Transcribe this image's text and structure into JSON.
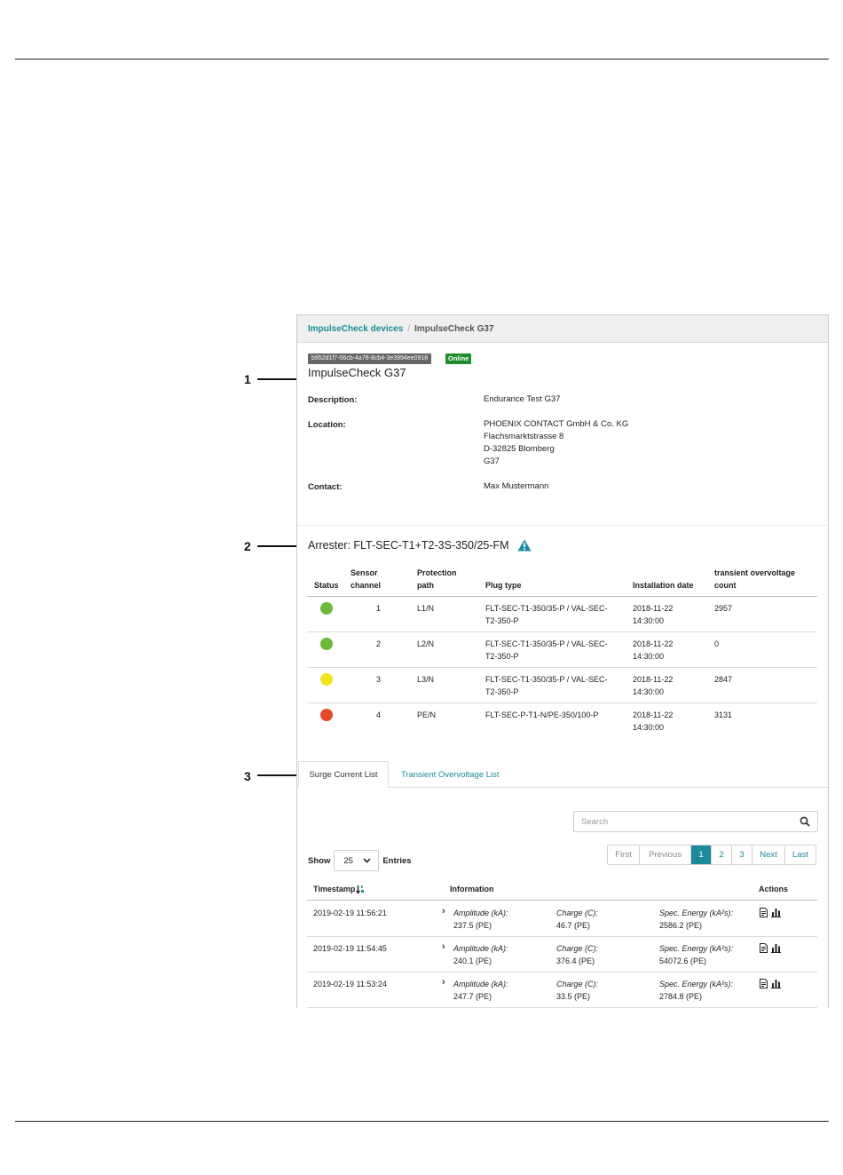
{
  "callouts": [
    "1",
    "2",
    "3"
  ],
  "breadcrumb": {
    "parent": "ImpulseCheck devices",
    "separator": "/",
    "current": "ImpulseCheck G37"
  },
  "device": {
    "id_badge": "b952d1f7-06cb-4a78-8cb4-3e3994ee0918",
    "status_badge": "Online",
    "title": "ImpulseCheck G37",
    "description_label": "Description:",
    "description": "Endurance Test G37",
    "location_label": "Location:",
    "location": [
      "PHOENIX CONTACT GmbH & Co. KG",
      "Flachsmarktstrasse 8",
      "D-32825 Blomberg",
      "G37"
    ],
    "contact_label": "Contact:",
    "contact": "Max Mustermann"
  },
  "arrester": {
    "title": "Arrester: FLT-SEC-T1+T2-3S-350/25-FM",
    "warning_icon": "warning-triangle-icon",
    "headers": {
      "status": "Status",
      "sensor_1": "Sensor",
      "sensor_2": "channel",
      "path_1": "Protection",
      "path_2": "path",
      "plug": "Plug type",
      "install": "Installation date",
      "count_1": "transient overvoltage",
      "count_2": "count"
    },
    "rows": [
      {
        "status_color": "#6bb83a",
        "channel": "1",
        "path": "L1/N",
        "plug_1": "FLT-SEC-T1-350/35-P / VAL-SEC-",
        "plug_2": "T2-350-P",
        "date": "2018-11-22",
        "time": "14:30:00",
        "count": "2957"
      },
      {
        "status_color": "#6bb83a",
        "channel": "2",
        "path": "L2/N",
        "plug_1": "FLT-SEC-T1-350/35-P / VAL-SEC-",
        "plug_2": "T2-350-P",
        "date": "2018-11-22",
        "time": "14:30:00",
        "count": "0"
      },
      {
        "status_color": "#f2e41c",
        "channel": "3",
        "path": "L3/N",
        "plug_1": "FLT-SEC-T1-350/35-P / VAL-SEC-",
        "plug_2": "T2-350-P",
        "date": "2018-11-22",
        "time": "14:30:00",
        "count": "2847"
      },
      {
        "status_color": "#e5482b",
        "channel": "4",
        "path": "PE/N",
        "plug_1": "FLT-SEC-P-T1-N/PE-350/100-P",
        "plug_2": "",
        "date": "2018-11-22",
        "time": "14:30:00",
        "count": "3131"
      }
    ]
  },
  "tabs": {
    "active": "Surge Current List",
    "other": "Transient Overvoltage List"
  },
  "search": {
    "placeholder": "Search"
  },
  "entries": {
    "show": "Show",
    "value": "25",
    "label": "Entries"
  },
  "pagination": {
    "first": "First",
    "previous": "Previous",
    "pages": [
      "1",
      "2",
      "3"
    ],
    "next": "Next",
    "last": "Last"
  },
  "surge_table": {
    "headers": {
      "timestamp": "Timestamp",
      "information": "Information",
      "actions": "Actions"
    },
    "amp_label": "Amplitude (kA):",
    "charge_label": "Charge (C):",
    "energy_label": "Spec. Energy (kA²s):",
    "rows": [
      {
        "timestamp": "2019-02-19 11:56:21",
        "amplitude": "237.5 (PE)",
        "charge": "46.7 (PE)",
        "energy": "2586.2 (PE)"
      },
      {
        "timestamp": "2019-02-19 11:54:45",
        "amplitude": "240.1 (PE)",
        "charge": "376.4 (PE)",
        "energy": "54072.6 (PE)"
      },
      {
        "timestamp": "2019-02-19 11:53:24",
        "amplitude": "247.7 (PE)",
        "charge": "33.5 (PE)",
        "energy": "2784.8 (PE)"
      }
    ]
  }
}
